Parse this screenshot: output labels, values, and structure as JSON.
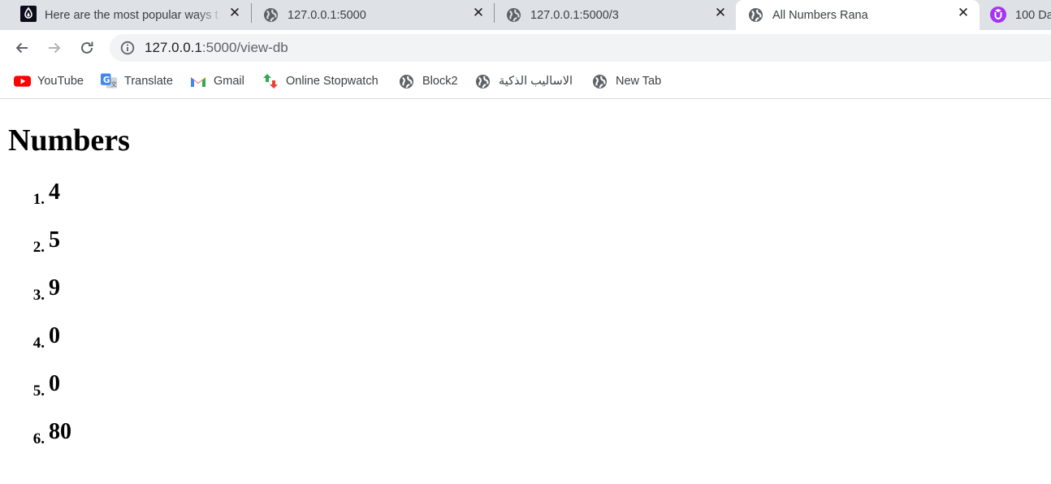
{
  "browser": {
    "tabs": [
      {
        "title": "Here are the most popular ways t",
        "favicon": "flask-icon",
        "active": false
      },
      {
        "title": "127.0.0.1:5000",
        "favicon": "globe-icon",
        "active": false
      },
      {
        "title": "127.0.0.1:5000/3",
        "favicon": "globe-icon",
        "active": false
      },
      {
        "title": "All Numbers Rana",
        "favicon": "globe-icon",
        "active": true
      },
      {
        "title": "100 Da",
        "favicon": "udemy-icon",
        "active": false
      }
    ],
    "address_bar": {
      "host": "127.0.0.1",
      "path": ":5000/view-db"
    },
    "bookmarks": [
      {
        "label": "YouTube",
        "icon": "youtube-icon"
      },
      {
        "label": "Translate",
        "icon": "translate-icon"
      },
      {
        "label": "Gmail",
        "icon": "gmail-icon"
      },
      {
        "label": "Online Stopwatch",
        "icon": "stopwatch-icon"
      },
      {
        "label": "Block2",
        "icon": "globe-icon"
      },
      {
        "label": "الاساليب الذكية",
        "icon": "globe-icon"
      },
      {
        "label": "New Tab",
        "icon": "globe-icon"
      }
    ]
  },
  "page": {
    "heading": "Numbers",
    "items": [
      {
        "marker": "1.",
        "value": "4"
      },
      {
        "marker": "2.",
        "value": "5"
      },
      {
        "marker": "3.",
        "value": "9"
      },
      {
        "marker": "4.",
        "value": "0"
      },
      {
        "marker": "5.",
        "value": "0"
      },
      {
        "marker": "6.",
        "value": "80"
      }
    ]
  },
  "colors": {
    "tabstrip": "#dee1e6",
    "omnibox": "#f1f3f4",
    "udemy_purple": "#a435f0",
    "youtube_red": "#ff0000"
  }
}
